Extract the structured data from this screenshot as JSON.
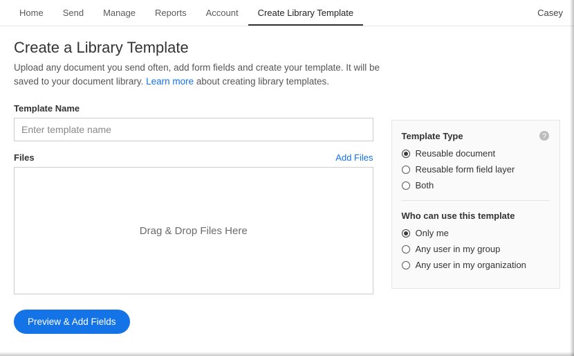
{
  "nav": {
    "items": [
      "Home",
      "Send",
      "Manage",
      "Reports",
      "Account",
      "Create Library Template"
    ],
    "activeIndex": 5,
    "user": "Casey"
  },
  "page": {
    "title": "Create a Library Template",
    "desc_a": "Upload any document you send often, add form fields and create your template. It will be saved to your document library. ",
    "learn_more": "Learn more",
    "desc_b": " about creating library templates."
  },
  "form": {
    "templateName": {
      "label": "Template Name",
      "placeholder": "Enter template name",
      "value": ""
    },
    "files": {
      "label": "Files",
      "addFiles": "Add Files",
      "dropzone": "Drag & Drop Files Here"
    },
    "submit": "Preview & Add Fields"
  },
  "side": {
    "templateType": {
      "title": "Template Type",
      "options": [
        {
          "label": "Reusable document",
          "selected": true
        },
        {
          "label": "Reusable form field layer",
          "selected": false
        },
        {
          "label": "Both",
          "selected": false
        }
      ]
    },
    "access": {
      "title": "Who can use this template",
      "options": [
        {
          "label": "Only me",
          "selected": true
        },
        {
          "label": "Any user in my group",
          "selected": false
        },
        {
          "label": "Any user in my organization",
          "selected": false
        }
      ]
    }
  }
}
